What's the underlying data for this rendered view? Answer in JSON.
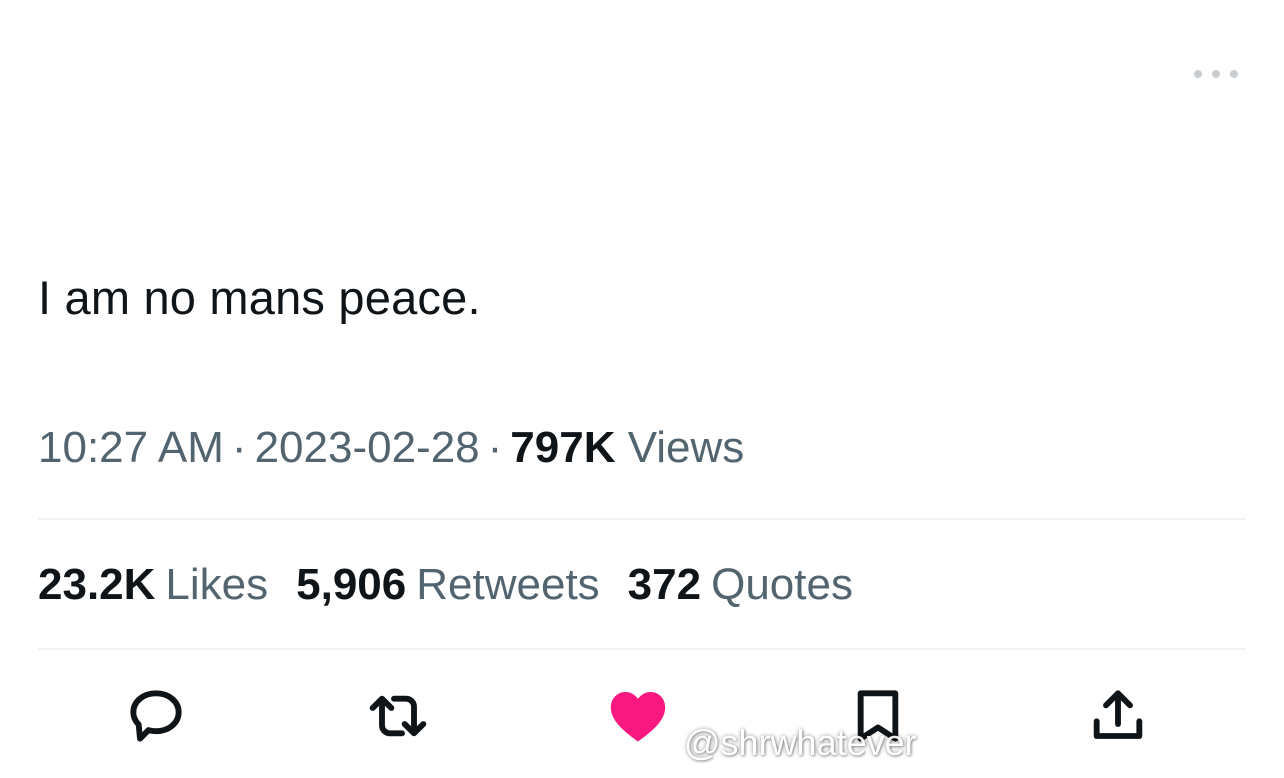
{
  "tweet": {
    "text": "I am no mans peace."
  },
  "meta": {
    "time": "10:27 AM",
    "separator": "·",
    "date": "2023-02-28",
    "views_count": "797K",
    "views_label": "Views"
  },
  "stats": {
    "likes_count": "23.2K",
    "likes_label": "Likes",
    "retweets_count": "5,906",
    "retweets_label": "Retweets",
    "quotes_count": "372",
    "quotes_label": "Quotes"
  },
  "actions": {
    "reply_icon": "reply-icon",
    "retweet_icon": "retweet-icon",
    "like_icon": "heart-icon",
    "like_state": "liked",
    "bookmark_icon": "bookmark-icon",
    "share_icon": "share-icon"
  },
  "watermark": {
    "handle": "@shrwhatever",
    "logo_icon": "tiktok-icon"
  },
  "colors": {
    "text_primary": "#0f1419",
    "text_secondary": "#536471",
    "divider": "#eff3f4",
    "like_active": "#f91880"
  }
}
